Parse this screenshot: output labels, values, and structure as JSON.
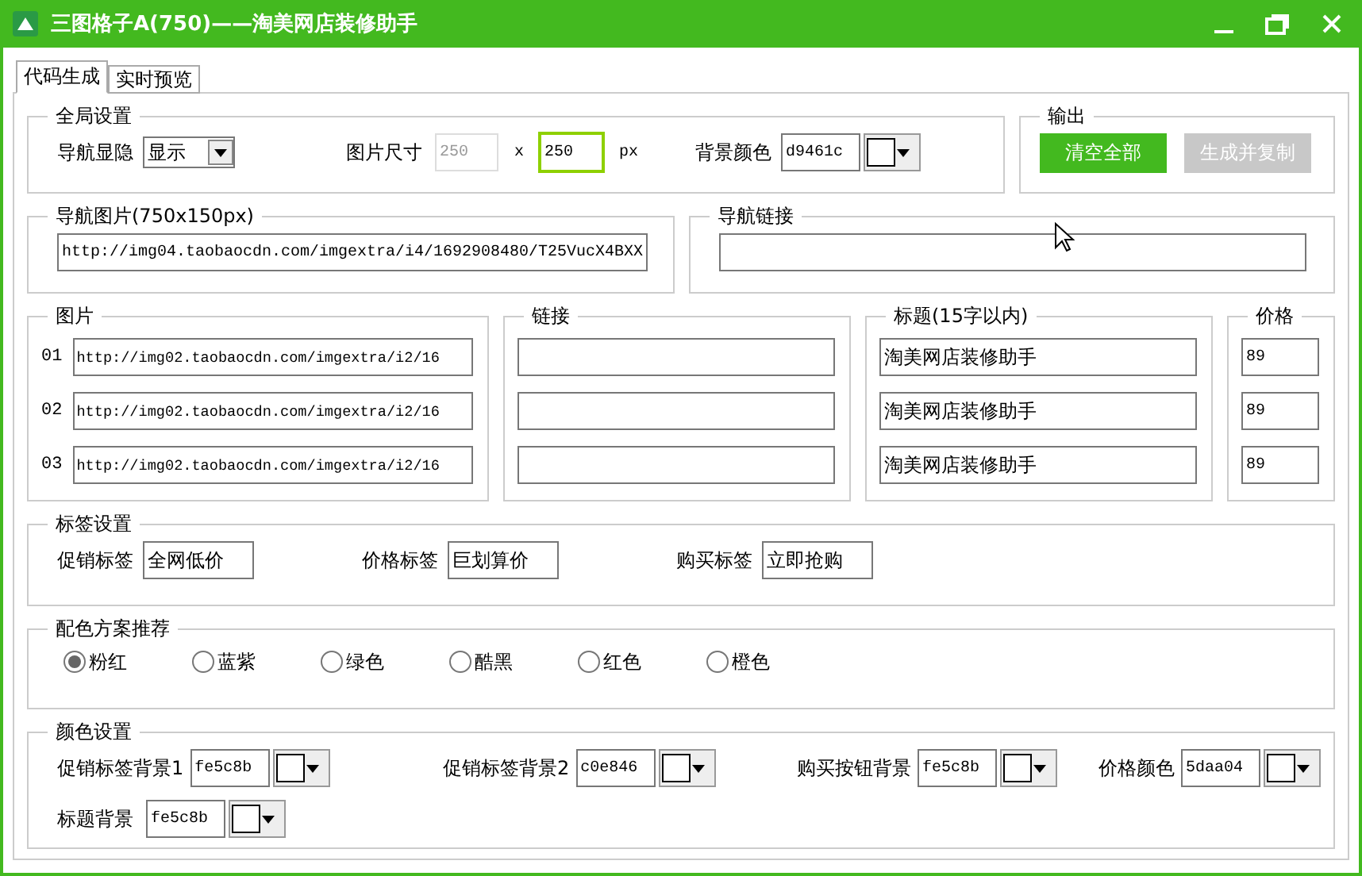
{
  "window": {
    "title": "三图格子A(750)——淘美网店装修助手"
  },
  "tabs": [
    {
      "label": "代码生成",
      "selected": true
    },
    {
      "label": "实时预览",
      "selected": false
    }
  ],
  "global_settings": {
    "title": "全局设置",
    "nav_visibility": {
      "label": "导航显隐",
      "value": "显示"
    },
    "image_size": {
      "label": "图片尺寸",
      "width": {
        "value": "250",
        "disabled": true,
        "focused": false
      },
      "separator": "x",
      "height": {
        "value": "250",
        "disabled": false,
        "focused": true
      },
      "unit": "px"
    },
    "bg_color": {
      "label": "背景颜色",
      "value": "d9461c"
    }
  },
  "output": {
    "title": "输出",
    "buttons": [
      {
        "label": "清空全部",
        "disabled": false
      },
      {
        "label": "生成并复制",
        "disabled": true
      }
    ]
  },
  "nav_image": {
    "title": "导航图片(750x150px)",
    "value": "http://img04.taobaocdn.com/imgextra/i4/1692908480/T25VucX4BXX"
  },
  "nav_link": {
    "title": "导航链接"
  },
  "items": {
    "image_title": "图片",
    "link_title": "链接",
    "title_title": "标题(15字以内)",
    "price_title": "价格",
    "rows": [
      {
        "index": "01",
        "image": "http://img02.taobaocdn.com/imgextra/i2/16",
        "title": "淘美网店装修助手",
        "price": "89"
      },
      {
        "index": "02",
        "image": "http://img02.taobaocdn.com/imgextra/i2/16",
        "title": "淘美网店装修助手",
        "price": "89"
      },
      {
        "index": "03",
        "image": "http://img02.taobaocdn.com/imgextra/i2/16",
        "title": "淘美网店装修助手",
        "price": "89"
      }
    ]
  },
  "tag_settings": {
    "title": "标签设置",
    "fields": [
      {
        "label": "促销标签",
        "value": "全网低价"
      },
      {
        "label": "价格标签",
        "value": "巨划算价"
      },
      {
        "label": "购买标签",
        "value": "立即抢购"
      }
    ]
  },
  "color_schemes": {
    "title": "配色方案推荐",
    "options": [
      {
        "label": "粉红",
        "selected": true
      },
      {
        "label": "蓝紫",
        "selected": false
      },
      {
        "label": "绿色",
        "selected": false
      },
      {
        "label": "酷黑",
        "selected": false
      },
      {
        "label": "红色",
        "selected": false
      },
      {
        "label": "橙色",
        "selected": false
      }
    ]
  },
  "color_settings": {
    "title": "颜色设置",
    "fields": [
      {
        "label": "促销标签背景1",
        "value": "fe5c8b"
      },
      {
        "label": "促销标签背景2",
        "value": "c0e846"
      },
      {
        "label": "购买按钮背景",
        "value": "fe5c8b"
      },
      {
        "label": "价格颜色",
        "value": "5daa04"
      },
      {
        "label": "标题背景",
        "value": "fe5c8b"
      }
    ]
  }
}
